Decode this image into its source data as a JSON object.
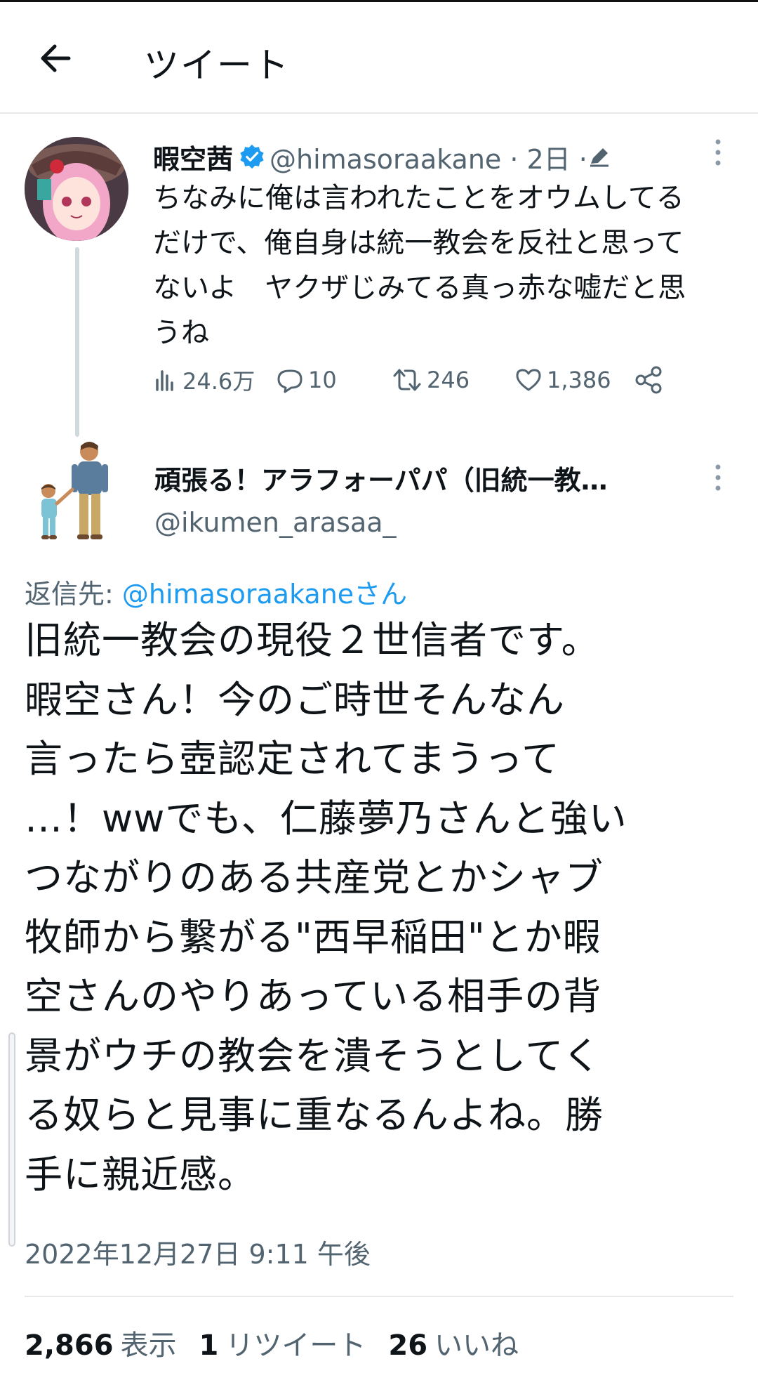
{
  "header": {
    "title": "ツイート",
    "back_icon": "arrow-left-icon"
  },
  "tweet1": {
    "display_name": "暇空茜",
    "verified": true,
    "handle_meta": "@himasoraakane · 2日 · ",
    "text": "ちなみに俺は言われたことをオウムしてる\nだけで、俺自身は統一教会を反社と思って\nないよ　ヤクザじみてる真っ赤な嘘だと思\nうね",
    "actions": {
      "views": "24.6万",
      "replies": "10",
      "retweets": "246",
      "likes": "1,386"
    }
  },
  "tweet2": {
    "display_name": "頑張る！アラフォーパパ（旧統一教…",
    "handle": "@ikumen_arasaa_",
    "reply_prefix": "返信先: ",
    "reply_mention": "@himasoraakaneさん",
    "text": "旧統一教会の現役２世信者です。\n暇空さん！今のご時世そんなん\n言ったら壺認定されてまうって\n…！wwでも、仁藤夢乃さんと強い\nつながりのある共産党とかシャブ\n牧師から繋がる\"西早稲田\"とか暇\n空さんのやりあっている相手の背\n景がウチの教会を潰そうとしてく\nる奴らと見事に重なるんよね。勝\n手に親近感。",
    "timestamp": "2022年12月27日 9:11 午後",
    "stats": {
      "views_num": "2,866",
      "views_label": "表示",
      "retweets_num": "1",
      "retweets_label": "リツイート",
      "likes_num": "26",
      "likes_label": "いいね"
    }
  },
  "colors": {
    "accent": "#1d9bf0",
    "secondary_text": "#536471",
    "primary_text": "#0f1419"
  }
}
